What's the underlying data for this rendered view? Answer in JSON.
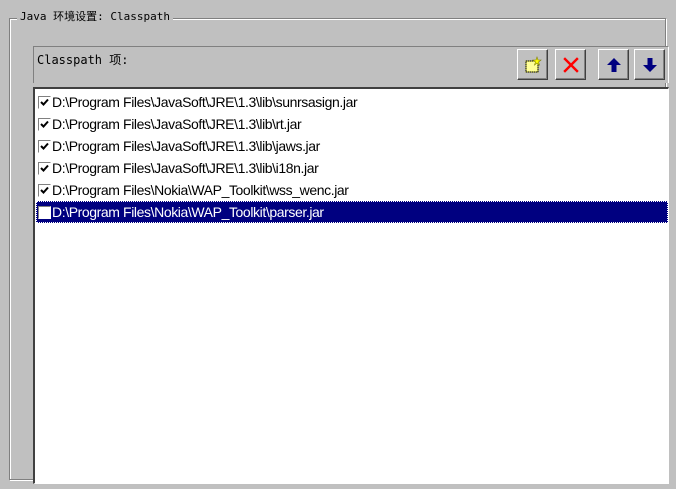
{
  "group": {
    "title": "Java 环境设置: Classpath"
  },
  "classpath_panel": {
    "label": "Classpath 项:",
    "toolbar": [
      {
        "name": "new-item-button",
        "icon": "new-item-icon"
      },
      {
        "name": "delete-item-button",
        "icon": "delete-x-icon",
        "color": "#ff0000"
      },
      {
        "name": "move-up-button",
        "icon": "arrow-up-icon",
        "color": "#000080"
      },
      {
        "name": "move-down-button",
        "icon": "arrow-down-icon",
        "color": "#000080"
      }
    ],
    "items": [
      {
        "path": "D:\\Program Files\\JavaSoft\\JRE\\1.3\\lib\\sunrsasign.jar",
        "checked": true,
        "selected": false
      },
      {
        "path": "D:\\Program Files\\JavaSoft\\JRE\\1.3\\lib\\rt.jar",
        "checked": true,
        "selected": false
      },
      {
        "path": "D:\\Program Files\\JavaSoft\\JRE\\1.3\\lib\\jaws.jar",
        "checked": true,
        "selected": false
      },
      {
        "path": "D:\\Program Files\\JavaSoft\\JRE\\1.3\\lib\\i18n.jar",
        "checked": true,
        "selected": false
      },
      {
        "path": "D:\\Program Files\\Nokia\\WAP_Toolkit\\wss_wenc.jar",
        "checked": true,
        "selected": false
      },
      {
        "path": "D:\\Program Files\\Nokia\\WAP_Toolkit\\parser.jar",
        "checked": false,
        "selected": true
      }
    ]
  },
  "colors": {
    "dialog_face": "#c0c0c0",
    "selection": "#000080",
    "list_background": "#ffffff"
  }
}
